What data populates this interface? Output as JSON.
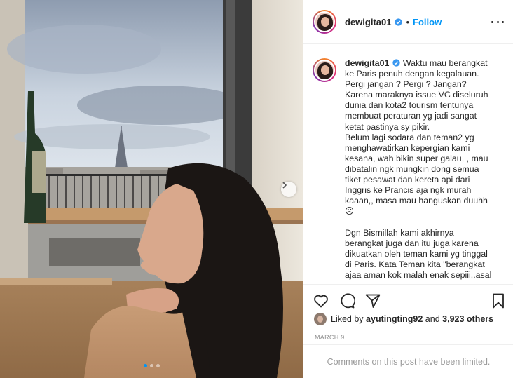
{
  "post": {
    "username": "dewigita01",
    "separator": "•",
    "follow_label": "Follow",
    "caption": "Waktu mau berangkat ke Paris penuh dengan kegalauan. Pergi jangan ? Pergi ? Jangan? Karena maraknya issue VC diseluruh dunia dan kota2 tourism tentunya membuat peraturan yg jadi sangat ketat pastinya sy pikir.\nBelum lagi sodara dan teman2 yg menghawatirkan kepergian kami kesana, wah bikin super galau, , mau dibatalin ngk mungkin dong semua tiket pesawat dan kereta api dari Inggris ke Prancis aja ngk murah kaaan,, masa mau hanguskan duuhh ☹\n\nDgn Bismillah kami akhirnya berangkat juga dan itu juga karena dikuatkan oleh teman kami yg tinggal di Paris. Kata Teman kita \"berangkat ajaa aman kok malah enak sepiii..asal",
    "liked_by_prefix": "Liked by",
    "liked_by_user": "ayutingting92",
    "liked_by_and": "and",
    "others_count": "3,923 others",
    "date": "MARCH 9",
    "comments_limited": "Comments on this post have been limited."
  },
  "carousel": {
    "current_index": 1,
    "total": 3
  },
  "icons": {
    "verified": "verified-badge-icon",
    "more": "more-options-icon",
    "like": "heart-icon",
    "comment": "comment-icon",
    "share": "paper-plane-icon",
    "save": "bookmark-icon",
    "next": "chevron-right-icon"
  },
  "colors": {
    "link_blue": "#0095f6",
    "muted": "#8e8e8e",
    "border": "#efefef"
  }
}
